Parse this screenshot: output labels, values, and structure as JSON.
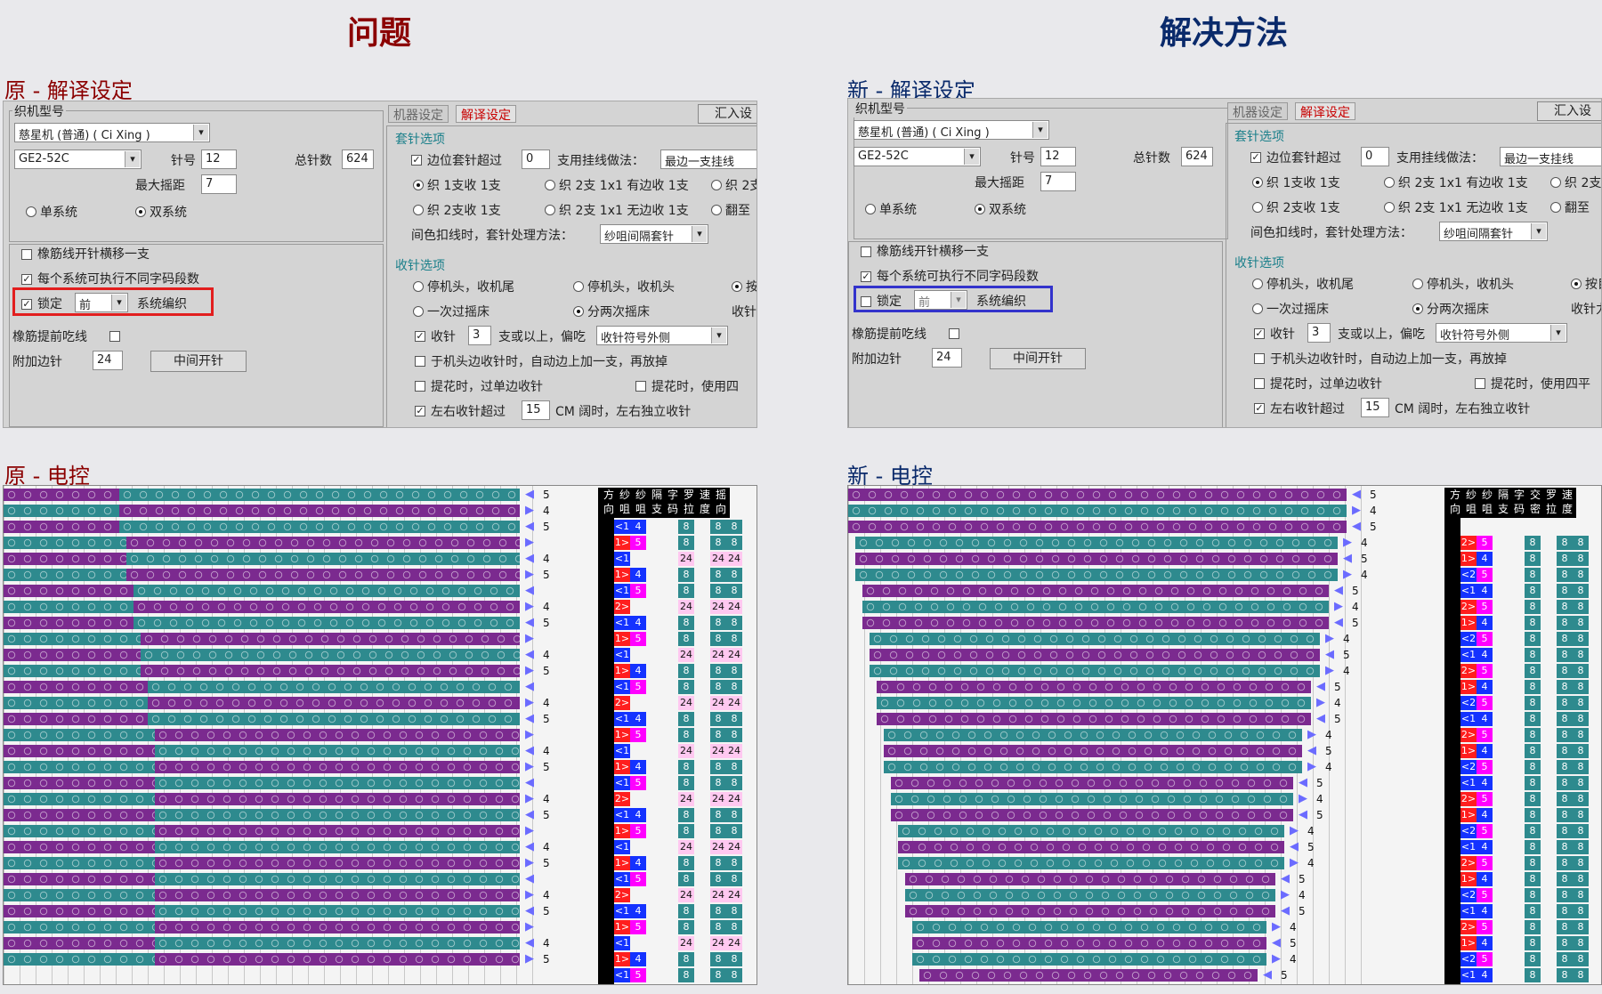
{
  "headings": {
    "left": "问题",
    "right": "解决方法"
  },
  "subtitles": {
    "left_setup": "原 - 解译设定",
    "right_setup": "新 - 解译设定",
    "left_ec": "原 - 电控",
    "right_ec": "新 - 电控"
  },
  "setup": {
    "machine_group": "织机型号",
    "machine": "慈星机 (普通) ( Ci Xing )",
    "model": "GE2-52C",
    "needle_label": "针号",
    "needle": "12",
    "total_label": "总针数",
    "total": "624",
    "maxrack_label": "最大摇距",
    "maxrack": "7",
    "single": "单系统",
    "double": "双系统",
    "opt1": "橡筋线开针横移一支",
    "opt2": "每个系统可执行不同字码段数",
    "lock": "锁定",
    "lock_value": "前",
    "sysknit": "系统编织",
    "rubber_eat": "橡筋提前吃线",
    "extra_needle": "附加边针",
    "extra_needle_value": "24",
    "middle_btn": "中间开针",
    "tab_machine": "机器设定",
    "tab_decode": "解译设定",
    "import_btn": "汇入设",
    "transfer_title": "套针选项",
    "edge_over": "边位套针超过",
    "edge_over_value": "0",
    "hang_method": "支用挂线做法：",
    "hang_value": "最边一支挂线",
    "r_k1": "织 1支收 1支",
    "r_k2": "织 2支 1x1 有边收 1支",
    "r_k3": "织 2支",
    "r_k4": "织 2支收 1支",
    "r_k5": "织 2支 1x1 无边收 1支",
    "r_k6": "翻至",
    "interval_label": "间色扣线时，套针处理方法：",
    "interval_value": "纱咀间隔套针",
    "narrow_title": "收针选项",
    "n1": "停机头，收机尾",
    "n2": "停机头，收机头",
    "n3": "按",
    "n3_right": "按目",
    "n4": "一次过摇床",
    "n5": "分两次摇床",
    "n6": "收针",
    "n6_right": "收针力",
    "narrow_cb": "收针",
    "narrow_value": "3",
    "narrow_above": "支或以上，偏吃",
    "narrow_side": "收针符号外侧",
    "auto_add": "于机头边收针时，自动边上加一支，再放掉",
    "jacquard1": "提花时，过单边收针",
    "jacquard2": "提花时，使用四",
    "jacquard2_right": "提花时，使用四平",
    "lr_over": "左右收针超过",
    "lr_value": "15",
    "lr_tail": "CM 阔时，左右独立收针"
  },
  "left_table": {
    "headers": [
      [
        "方",
        "向"
      ],
      [
        "纱",
        "咀"
      ],
      [
        "纱",
        "咀"
      ],
      [
        "隔",
        "支"
      ],
      [
        "字",
        "码"
      ],
      [
        "罗",
        "拉"
      ],
      [
        "速",
        "度"
      ],
      [
        "摇",
        "向"
      ]
    ]
  },
  "right_table": {
    "headers": [
      [
        "方",
        "向"
      ],
      [
        "纱",
        "咀"
      ],
      [
        "纱",
        "咀"
      ],
      [
        "隔",
        "支"
      ],
      [
        "字",
        "码"
      ],
      [
        "交",
        "密"
      ],
      [
        "罗",
        "拉"
      ],
      [
        "速",
        "度"
      ]
    ]
  },
  "left_rows": [
    {
      "l": 0,
      "s": "5",
      "d": "",
      "y": "",
      "z": "",
      "r": ""
    },
    {
      "l": 0,
      "s": "4",
      "d": "<1",
      "y": "4",
      "z": "8",
      "r": "8"
    },
    {
      "l": 0,
      "s": "5",
      "d": "1>",
      "y": "5",
      "z": "8",
      "r": "8"
    },
    {
      "l": 0,
      "s": "",
      "d": "<1",
      "y": "",
      "z": "24",
      "r": "24"
    },
    {
      "l": 0,
      "s": "4",
      "d": "1>",
      "y": "4",
      "z": "8",
      "r": "8"
    },
    {
      "l": 0,
      "s": "5",
      "d": "<1",
      "y": "5",
      "z": "8",
      "r": "8"
    },
    {
      "l": 0,
      "s": "",
      "d": "2>",
      "y": "",
      "z": "24",
      "r": "24"
    },
    {
      "l": 0,
      "s": "4",
      "d": "<1",
      "y": "4",
      "z": "8",
      "r": "8"
    },
    {
      "l": 0,
      "s": "5",
      "d": "1>",
      "y": "5",
      "z": "8",
      "r": "8"
    },
    {
      "l": 0,
      "s": "",
      "d": "<1",
      "y": "",
      "z": "24",
      "r": "24"
    },
    {
      "l": 0,
      "s": "4",
      "d": "1>",
      "y": "4",
      "z": "8",
      "r": "8"
    },
    {
      "l": 0,
      "s": "5",
      "d": "<1",
      "y": "5",
      "z": "8",
      "r": "8"
    },
    {
      "l": 0,
      "s": "",
      "d": "2>",
      "y": "",
      "z": "24",
      "r": "24"
    },
    {
      "l": 0,
      "s": "4",
      "d": "<1",
      "y": "4",
      "z": "8",
      "r": "8"
    },
    {
      "l": 0,
      "s": "5",
      "d": "1>",
      "y": "5",
      "z": "8",
      "r": "8"
    },
    {
      "l": 0,
      "s": "",
      "d": "<1",
      "y": "",
      "z": "24",
      "r": "24"
    },
    {
      "l": 0,
      "s": "4",
      "d": "1>",
      "y": "4",
      "z": "8",
      "r": "8"
    },
    {
      "l": 0,
      "s": "5",
      "d": "<1",
      "y": "5",
      "z": "8",
      "r": "8"
    },
    {
      "l": 0,
      "s": "",
      "d": "2>",
      "y": "",
      "z": "24",
      "r": "24"
    },
    {
      "l": 0,
      "s": "4",
      "d": "<1",
      "y": "4",
      "z": "8",
      "r": "8"
    },
    {
      "l": 0,
      "s": "5",
      "d": "1>",
      "y": "5",
      "z": "8",
      "r": "8"
    },
    {
      "l": 0,
      "s": "",
      "d": "<1",
      "y": "",
      "z": "24",
      "r": "24"
    },
    {
      "l": 0,
      "s": "4",
      "d": "1>",
      "y": "4",
      "z": "8",
      "r": "8"
    },
    {
      "l": 0,
      "s": "5",
      "d": "<1",
      "y": "5",
      "z": "8",
      "r": "8"
    },
    {
      "l": 0,
      "s": "",
      "d": "2>",
      "y": "",
      "z": "24",
      "r": "24"
    },
    {
      "l": 0,
      "s": "4",
      "d": "<1",
      "y": "4",
      "z": "8",
      "r": "8"
    },
    {
      "l": 0,
      "s": "5",
      "d": "1>",
      "y": "5",
      "z": "8",
      "r": "8"
    },
    {
      "l": 0,
      "s": "",
      "d": "<1",
      "y": "",
      "z": "24",
      "r": "24"
    },
    {
      "l": 0,
      "s": "4",
      "d": "1>",
      "y": "4",
      "z": "8",
      "r": "8"
    },
    {
      "l": 0,
      "s": "5",
      "d": "<1",
      "y": "5",
      "z": "8",
      "r": "8"
    }
  ],
  "right_rows": [
    {
      "s": "5",
      "d": "",
      "y": ""
    },
    {
      "s": "4",
      "d": "",
      "y": ""
    },
    {
      "s": "5",
      "d": "2>",
      "y": "5"
    },
    {
      "s": "4",
      "d": "1>",
      "y": "4"
    },
    {
      "s": "5",
      "d": "<2",
      "y": "5"
    },
    {
      "s": "4",
      "d": "<1",
      "y": "4"
    },
    {
      "s": "5",
      "d": "2>",
      "y": "5"
    },
    {
      "s": "4",
      "d": "1>",
      "y": "4"
    },
    {
      "s": "5",
      "d": "<2",
      "y": "5"
    },
    {
      "s": "4",
      "d": "<1",
      "y": "4"
    },
    {
      "s": "5",
      "d": "2>",
      "y": "5"
    },
    {
      "s": "4",
      "d": "1>",
      "y": "4"
    },
    {
      "s": "5",
      "d": "<2",
      "y": "5"
    },
    {
      "s": "4",
      "d": "<1",
      "y": "4"
    },
    {
      "s": "5",
      "d": "2>",
      "y": "5"
    },
    {
      "s": "4",
      "d": "1>",
      "y": "4"
    },
    {
      "s": "5",
      "d": "<2",
      "y": "5"
    },
    {
      "s": "4",
      "d": "<1",
      "y": "4"
    },
    {
      "s": "5",
      "d": "2>",
      "y": "5"
    },
    {
      "s": "4",
      "d": "1>",
      "y": "4"
    },
    {
      "s": "5",
      "d": "<2",
      "y": "5"
    },
    {
      "s": "4",
      "d": "<1",
      "y": "4"
    },
    {
      "s": "5",
      "d": "2>",
      "y": "5"
    },
    {
      "s": "4",
      "d": "1>",
      "y": "4"
    },
    {
      "s": "5",
      "d": "<2",
      "y": "5"
    },
    {
      "s": "4",
      "d": "<1",
      "y": "4"
    },
    {
      "s": "5",
      "d": "2>",
      "y": "5"
    },
    {
      "s": "4",
      "d": "1>",
      "y": "4"
    },
    {
      "s": "5",
      "d": "<2",
      "y": "5"
    },
    {
      "s": "4",
      "d": "<1",
      "y": "4"
    },
    {
      "s": "5",
      "d": "2>",
      "y": "5"
    }
  ],
  "colors": {
    "teal": "#2e8a8e",
    "purple": "#7b2a8f",
    "red_dir": "#ff1e1e",
    "blue_dir": "#1432ff",
    "magenta": "#ff00ff",
    "pink": "#ffc8f0",
    "highlight_red": "#e21e1e",
    "highlight_blue": "#3333cc"
  }
}
